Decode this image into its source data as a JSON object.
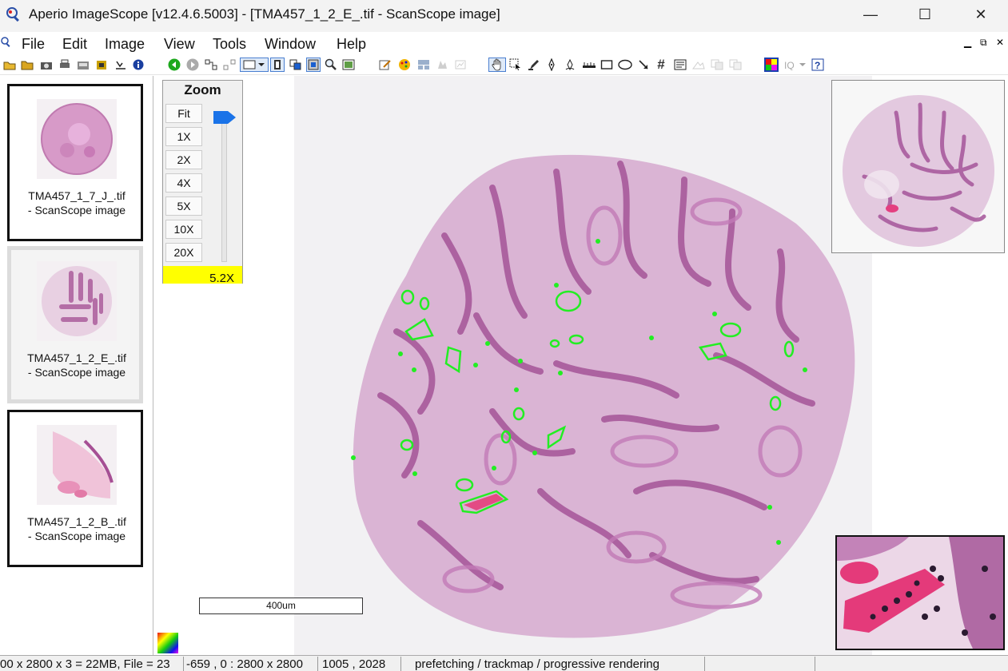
{
  "window": {
    "title": "Aperio ImageScope [v12.4.6.5003] - [TMA457_1_2_E_.tif - ScanScope image]",
    "minimize_label": "—",
    "maximize_label": "☐",
    "close_label": "✕"
  },
  "menu": {
    "items": [
      "File",
      "Edit",
      "Image",
      "View",
      "Tools",
      "Window",
      "Help"
    ],
    "mdi_controls": [
      "▁",
      "⧉",
      "✕"
    ]
  },
  "toolbar": {
    "icons": [
      "open-icon",
      "open-folder-icon",
      "camera-icon",
      "print-icon",
      "export-icon",
      "settings-icon",
      "annotation-icon",
      "info-icon",
      "back-icon",
      "forward-icon",
      "link-icon",
      "unlink-icon",
      "select-region-icon",
      "fullscreen-icon",
      "tile-icon",
      "copy-view-icon",
      "zoom-icon",
      "view-icon",
      "edit-icon",
      "palette-icon",
      "grid-icon",
      "disabled-icon-1",
      "disabled-icon-2",
      "pan-icon",
      "select-icon",
      "pen-tool-icon",
      "pen-icon",
      "freehand-icon",
      "ruler-icon",
      "rectangle-icon",
      "ellipse-icon",
      "arrow-icon",
      "hash-icon",
      "text-icon",
      "disabled-icon-3",
      "disabled-icon-4",
      "disabled-icon-5",
      "color-icon",
      "iq-icon",
      "help-icon"
    ]
  },
  "sidebar": {
    "thumbnails": [
      {
        "line1": "TMA457_1_7_J_.tif",
        "line2": "- ScanScope image"
      },
      {
        "line1": "TMA457_1_2_E_.tif",
        "line2": "- ScanScope image"
      },
      {
        "line1": "TMA457_1_2_B_.tif",
        "line2": "- ScanScope image"
      }
    ]
  },
  "zoom": {
    "title": "Zoom",
    "buttons": [
      "Fit",
      "1X",
      "2X",
      "4X",
      "5X",
      "10X",
      "20X"
    ],
    "level": "5.2X",
    "slider_fraction": 0.0
  },
  "scalebar": {
    "label": "400um"
  },
  "status": {
    "cells": [
      "00 x 2800 x 3 = 22MB, File = 23",
      "-659 , 0 : 2800 x 2800",
      "1005 , 2028",
      "prefetching / trackmap / progressive rendering"
    ]
  },
  "colors": {
    "accent": "#1a73e8",
    "annotation": "#22ee22",
    "zoom_indicator": "#ffff00",
    "tissue": "#c68ab8"
  }
}
